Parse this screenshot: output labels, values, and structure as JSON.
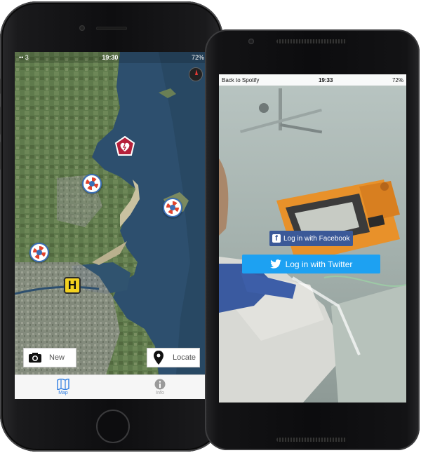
{
  "ios": {
    "status": {
      "carrier": "•• 3",
      "time": "19:30",
      "battery": "72%"
    },
    "map_buttons": {
      "new_label": "New",
      "locate_label": "Locate"
    },
    "tabs": [
      {
        "label": "Map",
        "icon": "map-icon",
        "active": true
      },
      {
        "label": "Info",
        "icon": "info-icon",
        "active": false
      }
    ],
    "markers": [
      "defibrillator-heart-icon",
      "lifebuoy-icon",
      "lifebuoy-icon",
      "lifebuoy-icon",
      "helipad-icon"
    ],
    "accent_color": "#2f7de1"
  },
  "android": {
    "status": {
      "back_label": "Back to Spotify",
      "time": "19:33",
      "battery": "72%"
    },
    "facebook_label": "Log in with Facebook",
    "twitter_label": "Log in with Twitter",
    "facebook_color": "#3b5998",
    "twitter_color": "#1da1f2"
  }
}
